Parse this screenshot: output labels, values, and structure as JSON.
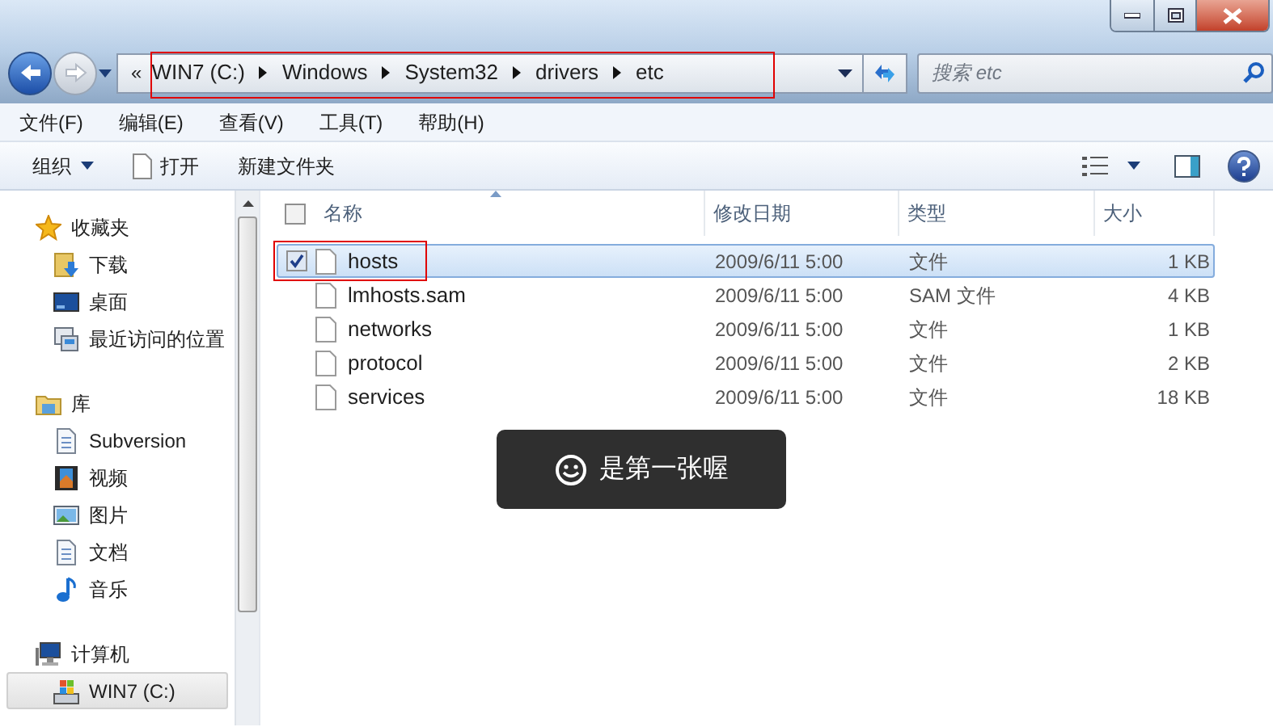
{
  "address": {
    "overflow": "«",
    "segments": [
      "WIN7 (C:)",
      "Windows",
      "System32",
      "drivers",
      "etc"
    ],
    "highlighted": true
  },
  "search": {
    "placeholder": "搜索 etc"
  },
  "menu": [
    "文件(F)",
    "编辑(E)",
    "查看(V)",
    "工具(T)",
    "帮助(H)"
  ],
  "toolbar": {
    "organize": "组织",
    "buttons": [
      {
        "label": "打开",
        "kind": "file"
      },
      {
        "label": "新建文件夹",
        "kind": "plain"
      }
    ]
  },
  "sidebar": [
    {
      "label": "收藏夹",
      "kind": "star",
      "selected": false,
      "children": [
        {
          "label": "下载",
          "kind": "download",
          "selected": false
        },
        {
          "label": "桌面",
          "kind": "desktop",
          "selected": false
        },
        {
          "label": "最近访问的位置",
          "kind": "recent",
          "selected": false
        }
      ]
    },
    {
      "label": "库",
      "kind": "library",
      "selected": false,
      "children": [
        {
          "label": "Subversion",
          "kind": "doc",
          "selected": false
        },
        {
          "label": "视频",
          "kind": "video",
          "selected": false
        },
        {
          "label": "图片",
          "kind": "image",
          "selected": false
        },
        {
          "label": "文档",
          "kind": "doc",
          "selected": false
        },
        {
          "label": "音乐",
          "kind": "music",
          "selected": false
        }
      ]
    },
    {
      "label": "计算机",
      "kind": "computer",
      "selected": false,
      "children": [
        {
          "label": "WIN7 (C:)",
          "kind": "drive",
          "selected": true
        }
      ]
    }
  ],
  "columns": [
    {
      "label": "名称",
      "sorted": true
    },
    {
      "label": "修改日期",
      "sorted": false
    },
    {
      "label": "类型",
      "sorted": false
    },
    {
      "label": "大小",
      "sorted": false
    }
  ],
  "header_checked": false,
  "rows": [
    {
      "name": "hosts",
      "date": "2009/6/11 5:00",
      "type": "文件",
      "size": "1 KB",
      "selected": true,
      "checked": true,
      "highlighted": true
    },
    {
      "name": "lmhosts.sam",
      "date": "2009/6/11 5:00",
      "type": "SAM 文件",
      "size": "4 KB",
      "selected": false,
      "checked": false,
      "highlighted": false
    },
    {
      "name": "networks",
      "date": "2009/6/11 5:00",
      "type": "文件",
      "size": "1 KB",
      "selected": false,
      "checked": false,
      "highlighted": false
    },
    {
      "name": "protocol",
      "date": "2009/6/11 5:00",
      "type": "文件",
      "size": "2 KB",
      "selected": false,
      "checked": false,
      "highlighted": false
    },
    {
      "name": "services",
      "date": "2009/6/11 5:00",
      "type": "文件",
      "size": "18 KB",
      "selected": false,
      "checked": false,
      "highlighted": false
    }
  ],
  "toast": {
    "text": "是第一张喔"
  }
}
